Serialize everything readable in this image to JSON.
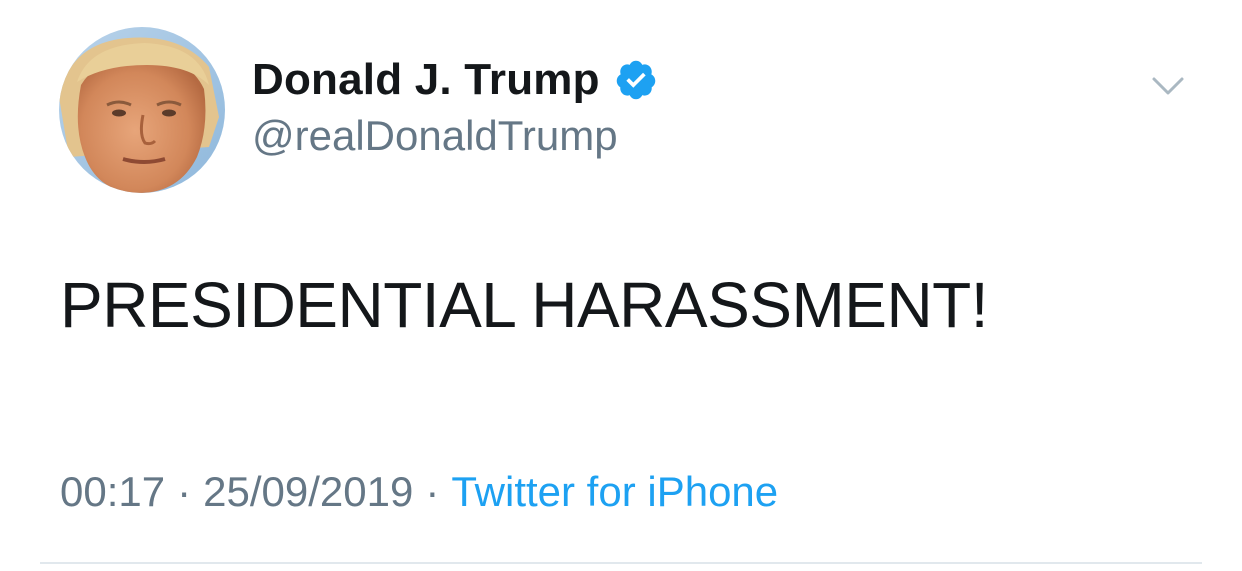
{
  "author": {
    "display_name": "Donald J. Trump",
    "handle": "@realDonaldTrump",
    "verified": true,
    "verified_color": "#1da1f2",
    "avatar_icon": "profile-photo"
  },
  "tweet": {
    "text": "PRESIDENTIAL HARASSMENT!",
    "time": "00:17",
    "separator": "·",
    "date": "25/09/2019",
    "source": "Twitter for iPhone",
    "source_color": "#1da1f2"
  },
  "menu": {
    "icon": "chevron-down-icon"
  }
}
